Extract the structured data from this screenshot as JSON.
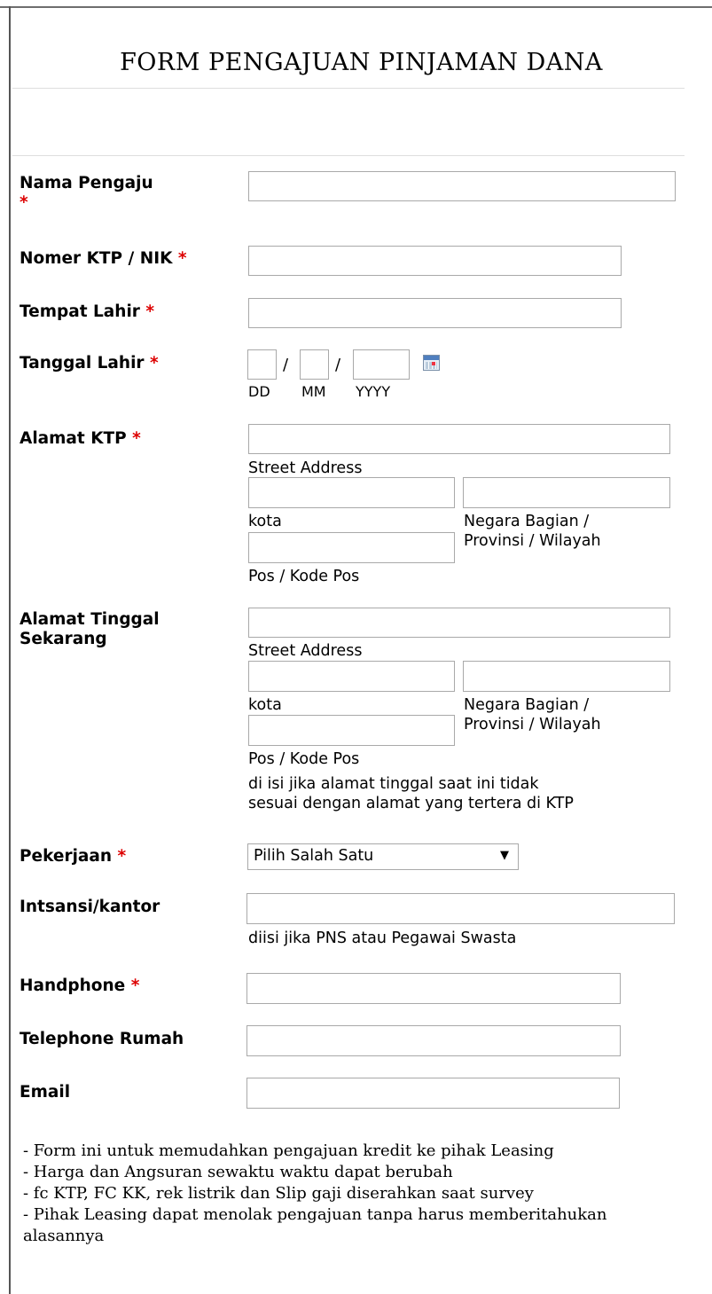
{
  "title": "FORM PENGAJUAN PINJAMAN DANA",
  "required_mark": "*",
  "fields": {
    "nama": {
      "label": "Nama Pengaju"
    },
    "ktp": {
      "label": "Nomer KTP / NIK"
    },
    "tempat": {
      "label": "Tempat Lahir"
    },
    "tanggal": {
      "label": "Tanggal Lahir",
      "slash": "/",
      "dd": "DD",
      "mm": "MM",
      "yyyy": "YYYY"
    },
    "alamat_ktp": {
      "label": "Alamat KTP",
      "street": "Street Address",
      "kota": "kota",
      "negara_1": "Negara Bagian /",
      "negara_2": "Provinsi / Wilayah",
      "pos": "Pos / Kode Pos"
    },
    "alamat_tinggal": {
      "label_1": "Alamat Tinggal",
      "label_2": "Sekarang",
      "street": "Street Address",
      "kota": "kota",
      "negara_1": "Negara Bagian /",
      "negara_2": "Provinsi / Wilayah",
      "pos": "Pos / Kode Pos",
      "hint_1": "di isi jika alamat tinggal saat ini tidak",
      "hint_2": "sesuai dengan alamat yang tertera di KTP"
    },
    "pekerjaan": {
      "label": "Pekerjaan",
      "selected": "Pilih Salah Satu",
      "arrow": "▼"
    },
    "instansi": {
      "label": "Intsansi/kantor",
      "hint": "diisi jika PNS atau Pegawai Swasta"
    },
    "handphone": {
      "label": "Handphone"
    },
    "telepon": {
      "label": "Telephone Rumah"
    },
    "email": {
      "label": "Email"
    }
  },
  "notes": [
    "- Form ini untuk memudahkan pengajuan kredit ke pihak Leasing",
    "- Harga dan Angsuran sewaktu waktu dapat berubah",
    "- fc KTP, FC KK, rek listrik dan Slip gaji diserahkan saat survey",
    "- Pihak Leasing dapat menolak pengajuan tanpa harus memberitahukan",
    "alasannya"
  ]
}
